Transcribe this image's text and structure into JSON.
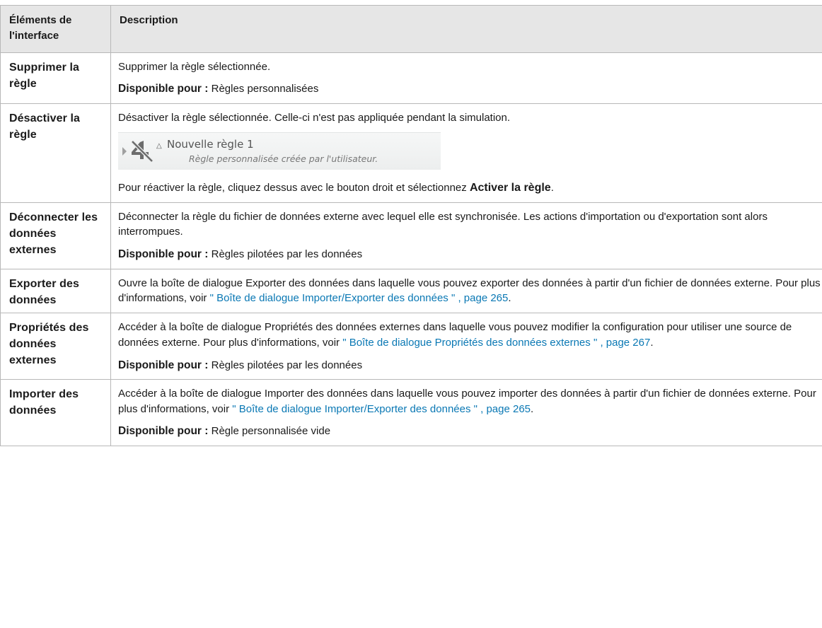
{
  "table": {
    "header": {
      "col1": "Éléments de l'interface",
      "col2": "Description"
    },
    "rows": [
      {
        "name": "Supprimer la règle",
        "description": "Supprimer la règle sélectionnée.",
        "available_label": "Disponible pour :",
        "available_value": " Règles personnalisées"
      },
      {
        "name": "Désactiver la règle",
        "description": "Désactiver la règle sélectionnée. Celle-ci n'est pas appliquée pendant la simulation.",
        "preview": {
          "rule_name": "Nouvelle règle 1",
          "rule_desc": "Règle personnalisée créée par l'utilisateur.",
          "icon": "disabled-rule-icon"
        },
        "reactivate_prefix": "Pour réactiver la règle, cliquez dessus avec le bouton droit et sélectionnez ",
        "reactivate_strong": "Activer la règle",
        "reactivate_suffix": "."
      },
      {
        "name": "Déconnecter les données externes",
        "description": "Déconnecter la règle du fichier de données externe avec lequel elle est synchronisée. Les actions d'importation ou d'exportation sont alors interrompues.",
        "available_label": "Disponible pour :",
        "available_value": " Règles pilotées par les données"
      },
      {
        "name": "Exporter des données",
        "description_prefix": "Ouvre la boîte de dialogue Exporter des données dans laquelle vous pouvez exporter des données à partir d'un fichier de données externe. Pour plus d'informations, voir ",
        "link": "\" Boîte de dialogue Importer/Exporter des données \" , page 265",
        "description_suffix": "."
      },
      {
        "name": "Propriétés des données externes",
        "description_prefix": "Accéder à la boîte de dialogue Propriétés des données externes dans laquelle vous pouvez modifier la configuration pour utiliser une source de données externe. Pour plus d'informations, voir ",
        "link": "\" Boîte de dialogue Propriétés des données externes \" , page 267",
        "description_suffix": ".",
        "available_label": "Disponible pour :",
        "available_value": " Règles pilotées par les données"
      },
      {
        "name": "Importer des données",
        "description_prefix": "Accéder à la boîte de dialogue Importer des données dans laquelle vous pouvez importer des données à partir d'un fichier de données externe. Pour plus d'informations, voir ",
        "link": "\" Boîte de dialogue Importer/Exporter des données \" , page 265",
        "description_suffix": ".",
        "available_label": "Disponible pour :",
        "available_value": " Règle personnalisée vide"
      }
    ]
  },
  "colors": {
    "link": "#0a78b4",
    "header_bg": "#e6e6e6",
    "border": "#b8b8b8"
  }
}
